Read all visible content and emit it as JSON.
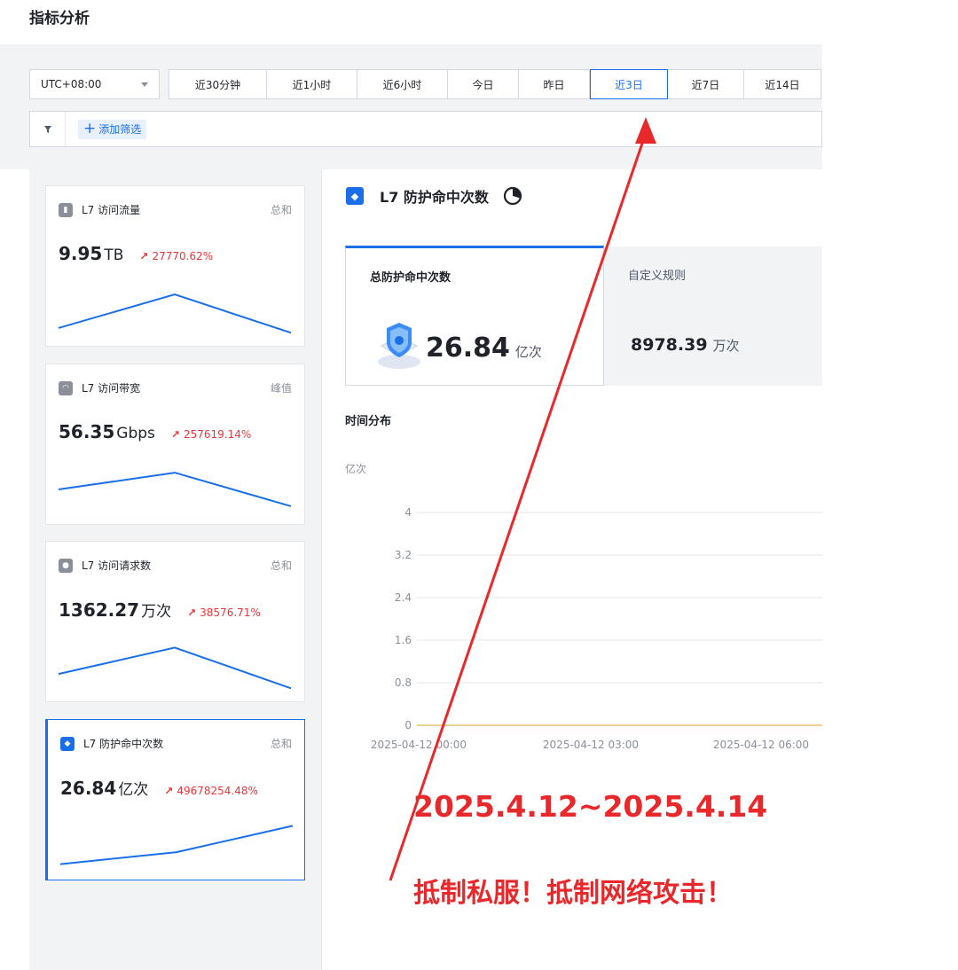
{
  "page": {
    "title": "指标分析"
  },
  "time_bar": {
    "timezone": "UTC+08:00",
    "ranges": [
      {
        "label": "近30分钟",
        "active": false
      },
      {
        "label": "近1小时",
        "active": false
      },
      {
        "label": "近6小时",
        "active": false
      },
      {
        "label": "今日",
        "active": false
      },
      {
        "label": "昨日",
        "active": false
      },
      {
        "label": "近3日",
        "active": true
      },
      {
        "label": "近7日",
        "active": false
      },
      {
        "label": "近14日",
        "active": false
      }
    ]
  },
  "filter": {
    "add_label": "添加筛选",
    "icon": "funnel-icon"
  },
  "metrics": [
    {
      "name": "L7 访问流量",
      "agg": "总和",
      "value": "9.95",
      "unit": "TB",
      "trend": "27770.62%",
      "icon": "bar-chart-icon",
      "spark": [
        0.15,
        0.85,
        0.05
      ]
    },
    {
      "name": "L7 访问带宽",
      "agg": "峰值",
      "value": "56.35",
      "unit": "Gbps",
      "trend": "257619.14%",
      "icon": "gauge-icon",
      "spark": [
        0.5,
        0.85,
        0.15
      ]
    },
    {
      "name": "L7 访问请求数",
      "agg": "总和",
      "value": "1362.27",
      "unit": "万次",
      "trend": "38576.71%",
      "icon": "user-icon",
      "spark": [
        0.35,
        0.9,
        0.05
      ]
    },
    {
      "name": "L7 防护命中次数",
      "agg": "总和",
      "value": "26.84",
      "unit": "亿次",
      "trend": "49678254.48%",
      "icon": "shield-icon",
      "active": true,
      "spark": [
        0.1,
        0.35,
        0.9
      ]
    }
  ],
  "main": {
    "title": "L7 防护命中次数",
    "total_card": {
      "label": "总防护命中次数",
      "value": "26.84",
      "unit": "亿次"
    },
    "custom_card": {
      "label": "自定义规则",
      "value": "8978.39",
      "unit": "万次"
    },
    "section_title": "时间分布",
    "y_unit": "亿次"
  },
  "chart_data": {
    "type": "line",
    "x": [
      "2025-04-12 00:00",
      "2025-04-12 03:00",
      "2025-04-12 06:00"
    ],
    "y_ticks": [
      "4",
      "3.2",
      "2.4",
      "1.6",
      "0.8",
      "0"
    ],
    "ylim": [
      0,
      4
    ],
    "series": [
      {
        "values": [
          0,
          0,
          0
        ]
      }
    ],
    "colors": {
      "line": "#e0c36a",
      "grid": "#e5e6eb"
    }
  },
  "annotation": {
    "date_range": "2025.4.12~2025.4.14",
    "slogan": "抵制私服！抵制网络攻击！",
    "color": "#e8282b"
  },
  "colors": {
    "accent": "#1a6fe8",
    "trend_up": "#e8363b"
  }
}
